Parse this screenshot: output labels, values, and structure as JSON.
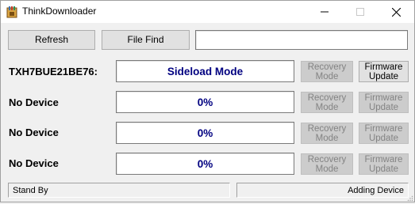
{
  "window": {
    "title": "ThinkDownloader",
    "controls": {
      "minimize": "minimize",
      "maximize": "maximize",
      "close": "close"
    }
  },
  "toolbar": {
    "refresh_label": "Refresh",
    "file_find_label": "File Find",
    "path_value": ""
  },
  "devices": [
    {
      "name": "TXH7BUE21BE76:",
      "status": "Sideload Mode",
      "recovery_line1": "Recovery",
      "recovery_line2": "Mode",
      "firmware_line1": "Firmware",
      "firmware_line2": "Update",
      "recovery_enabled": false,
      "firmware_enabled": true
    },
    {
      "name": "No Device",
      "status": "0%",
      "recovery_line1": "Recovery",
      "recovery_line2": "Mode",
      "firmware_line1": "Firmware",
      "firmware_line2": "Update",
      "recovery_enabled": false,
      "firmware_enabled": false
    },
    {
      "name": "No Device",
      "status": "0%",
      "recovery_line1": "Recovery",
      "recovery_line2": "Mode",
      "firmware_line1": "Firmware",
      "firmware_line2": "Update",
      "recovery_enabled": false,
      "firmware_enabled": false
    },
    {
      "name": "No Device",
      "status": "0%",
      "recovery_line1": "Recovery",
      "recovery_line2": "Mode",
      "firmware_line1": "Firmware",
      "firmware_line2": "Update",
      "recovery_enabled": false,
      "firmware_enabled": false
    }
  ],
  "statusbar": {
    "left": "Stand By",
    "right": "Adding Device"
  },
  "colors": {
    "status_text": "#000080",
    "focus_border": "#0078d7",
    "disabled_text": "#838383"
  },
  "icons": {
    "app": "app-icon",
    "minimize": "minimize-icon",
    "maximize": "maximize-icon",
    "close": "close-icon"
  }
}
